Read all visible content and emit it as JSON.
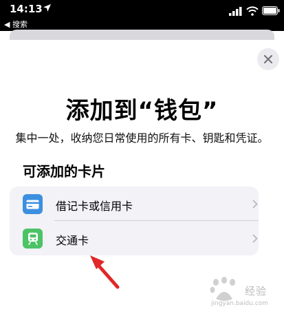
{
  "status_bar": {
    "time": "14:13",
    "back_label": "◀ 搜索",
    "icons": [
      "location-arrow-icon",
      "cellular-signal-icon",
      "wifi-icon",
      "battery-icon"
    ]
  },
  "sheet": {
    "title": "添加到“钱包”",
    "subtitle": "集中一处，收纳您日常使用的所有卡、钥匙和凭证。",
    "section_title": "可添加的卡片",
    "items": [
      {
        "label": "借记卡或信用卡",
        "icon": "credit-card-icon",
        "color": "#3d8fe0"
      },
      {
        "label": "交通卡",
        "icon": "train-icon",
        "color": "#4cc365"
      }
    ]
  },
  "watermark": {
    "text": "经验",
    "url": "jingyan.baidu.com"
  },
  "colors": {
    "annotation_arrow": "#e02828",
    "sheet_background": "#ffffff",
    "list_background": "#f2f2f7"
  }
}
